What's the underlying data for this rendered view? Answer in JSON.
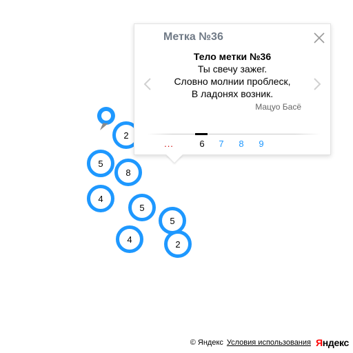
{
  "map": {
    "clusters": [
      {
        "id": "c1",
        "count": "2"
      },
      {
        "id": "c2",
        "count": "5"
      },
      {
        "id": "c3",
        "count": "8"
      },
      {
        "id": "c4",
        "count": "4"
      },
      {
        "id": "c5",
        "count": "5"
      },
      {
        "id": "c6",
        "count": "5"
      },
      {
        "id": "c7",
        "count": "4"
      },
      {
        "id": "c8",
        "count": "2"
      }
    ],
    "accent_color": "#1e98ff"
  },
  "balloon": {
    "title": "Метка №36",
    "body_header": "Тело метки №36",
    "body_lines": [
      "Ты свечу зажег.",
      "Словно молнии проблеск,",
      "В ладонях возник."
    ],
    "footer": "Мацуо Басё",
    "pager": {
      "ellipsis": "...",
      "pages": [
        "6",
        "7",
        "8",
        "9"
      ],
      "active": "6"
    },
    "close_icon": "close-icon",
    "prev_icon": "chevron-left-icon",
    "next_icon": "chevron-right-icon"
  },
  "copyrights": {
    "text": "© Яндекс",
    "terms_link": "Условия использования",
    "logo_first": "Я",
    "logo_rest": "ндекс"
  }
}
